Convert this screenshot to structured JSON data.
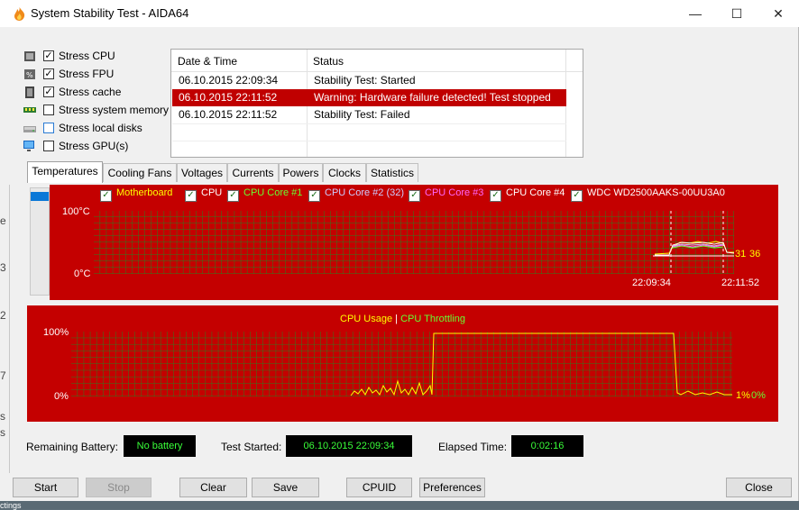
{
  "window": {
    "title": "System Stability Test - AIDA64",
    "minimize": "—",
    "maximize": "☐",
    "close": "✕"
  },
  "stress": [
    {
      "label": "Stress CPU",
      "checked": true,
      "icon": "cpu-icon"
    },
    {
      "label": "Stress FPU",
      "checked": true,
      "icon": "fpu-icon"
    },
    {
      "label": "Stress cache",
      "checked": true,
      "icon": "cache-icon"
    },
    {
      "label": "Stress system memory",
      "checked": false,
      "icon": "memory-icon"
    },
    {
      "label": "Stress local disks",
      "checked": false,
      "icon": "disk-icon"
    },
    {
      "label": "Stress GPU(s)",
      "checked": false,
      "icon": "gpu-icon"
    }
  ],
  "log": {
    "headers": [
      "Date & Time",
      "Status"
    ],
    "rows": [
      {
        "time": "06.10.2015 22:09:34",
        "status": "Stability Test: Started",
        "alert": false
      },
      {
        "time": "06.10.2015 22:11:52",
        "status": "Warning: Hardware failure detected! Test stopped",
        "alert": true
      },
      {
        "time": "06.10.2015 22:11:52",
        "status": "Stability Test: Failed",
        "alert": false
      }
    ]
  },
  "tabs": [
    "Temperatures",
    "Cooling Fans",
    "Voltages",
    "Currents",
    "Powers",
    "Clocks",
    "Statistics"
  ],
  "temp_chart": {
    "legend": [
      {
        "label": "Motherboard",
        "color": "#ffff00"
      },
      {
        "label": "CPU",
        "color": "#ffffff"
      },
      {
        "label": "CPU Core #1",
        "color": "#66ff33"
      },
      {
        "label": "CPU Core #2 (32)",
        "color": "#ccccff"
      },
      {
        "label": "CPU Core #3",
        "color": "#ff66ff"
      },
      {
        "label": "CPU Core #4",
        "color": "#ffffff"
      },
      {
        "label": "WDC WD2500AAKS-00UU3A0",
        "color": "#ffffff"
      }
    ],
    "y_top": "100°C",
    "y_bottom": "0°C",
    "x_start": "22:09:34",
    "x_end": "22:11:52",
    "end_values": [
      "31",
      "36"
    ]
  },
  "cpu_chart": {
    "legend_usage": "CPU Usage",
    "legend_sep": "|",
    "legend_throttle": "CPU Throttling",
    "usage_color": "#ffff00",
    "throttle_color": "#66ff33",
    "y_top": "100%",
    "y_bottom": "0%",
    "end_usage": "1%",
    "end_throttle": "0%"
  },
  "status_bar": {
    "battery_label": "Remaining Battery:",
    "battery_value": "No battery",
    "started_label": "Test Started:",
    "started_value": "06.10.2015 22:09:34",
    "elapsed_label": "Elapsed Time:",
    "elapsed_value": "0:02:16"
  },
  "buttons": {
    "start": "Start",
    "stop": "Stop",
    "clear": "Clear",
    "save": "Save",
    "cpuid": "CPUID",
    "preferences": "Preferences",
    "close": "Close"
  },
  "background": {
    "left_fragments": [
      "e",
      "3",
      "2",
      "7",
      "s",
      "s"
    ],
    "bottom_fragment": "ctings"
  }
}
